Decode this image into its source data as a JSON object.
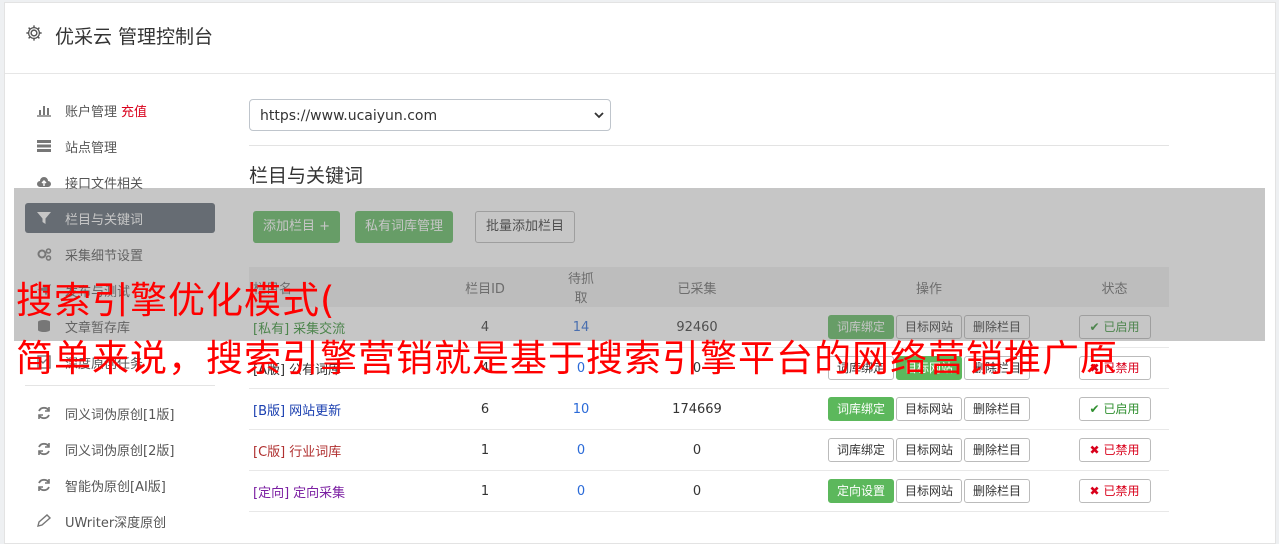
{
  "header": {
    "title": "优采云 管理控制台",
    "icon": "gear-icon"
  },
  "sidebar": {
    "items": [
      {
        "label": "账户管理",
        "extra": "充值",
        "icon": "bar-chart-icon"
      },
      {
        "label": "站点管理",
        "icon": "server-icon"
      },
      {
        "label": "接口文件相关",
        "icon": "cloud-upload-icon"
      },
      {
        "label": "栏目与关键词",
        "icon": "filter-icon",
        "active": true
      },
      {
        "label": "采集细节设置",
        "icon": "cogs-icon"
      },
      {
        "label": "发布与测试",
        "icon": "send-icon"
      },
      {
        "label": "文章暂存库",
        "icon": "database-icon"
      },
      {
        "label": "深度原创任务",
        "icon": "clipboard-icon"
      }
    ],
    "tools": [
      {
        "label": "同义词伪原创[1版]",
        "icon": "refresh-icon"
      },
      {
        "label": "同义词伪原创[2版]",
        "icon": "refresh-icon"
      },
      {
        "label": "智能伪原创[AI版]",
        "icon": "refresh-icon"
      },
      {
        "label": "UWriter深度原创",
        "icon": "edit-icon"
      }
    ]
  },
  "main": {
    "site_select": {
      "value": "https://www.ucaiyun.com"
    },
    "section_title": "栏目与关键词",
    "buttons": {
      "add": "添加栏目 +",
      "private_lib": "私有词库管理",
      "batch_add": "批量添加栏目"
    },
    "table": {
      "headers": [
        "栏目名",
        "栏目ID",
        "待抓取",
        "已采集",
        "操作",
        "状态"
      ],
      "rows": [
        {
          "tag": "[私有]",
          "name": "采集交流",
          "tag_color": "#2f8f2f",
          "id": "4",
          "pending": "14",
          "collected": "92460",
          "op1": "词库绑定",
          "op1_green": true,
          "op2": "目标网站",
          "op2_green": false,
          "op3": "删除栏目",
          "status": "已启用",
          "enabled": true
        },
        {
          "tag": "[A版]",
          "name": "公有词库",
          "tag_color": "#333333",
          "id": "4",
          "pending": "0",
          "collected": "0",
          "op1": "词库绑定",
          "op1_green": false,
          "op2": "目标网站",
          "op2_green": true,
          "op3": "删除栏目",
          "status": "已禁用",
          "enabled": false
        },
        {
          "tag": "[B版]",
          "name": "网站更新",
          "tag_color": "#1a3fb0",
          "id": "6",
          "pending": "10",
          "collected": "174669",
          "op1": "词库绑定",
          "op1_green": true,
          "op2": "目标网站",
          "op2_green": false,
          "op3": "删除栏目",
          "status": "已启用",
          "enabled": true
        },
        {
          "tag": "[C版]",
          "name": "行业词库",
          "tag_color": "#b03030",
          "id": "1",
          "pending": "0",
          "collected": "0",
          "op1": "词库绑定",
          "op1_green": false,
          "op2": "目标网站",
          "op2_green": false,
          "op3": "删除栏目",
          "status": "已禁用",
          "enabled": false
        },
        {
          "tag": "[定向]",
          "name": "定向采集",
          "tag_color": "#7b1fa2",
          "id": "1",
          "pending": "0",
          "collected": "0",
          "op1": "定向设置",
          "op1_green": true,
          "op2": "目标网站",
          "op2_green": false,
          "op3": "删除栏目",
          "status": "已禁用",
          "enabled": false
        }
      ]
    }
  },
  "overlay": {
    "line1": "搜索引擎优化模式(",
    "line2": "简单来说，搜索引擎营销就是基于搜索引擎平台的网络营销推广原"
  }
}
